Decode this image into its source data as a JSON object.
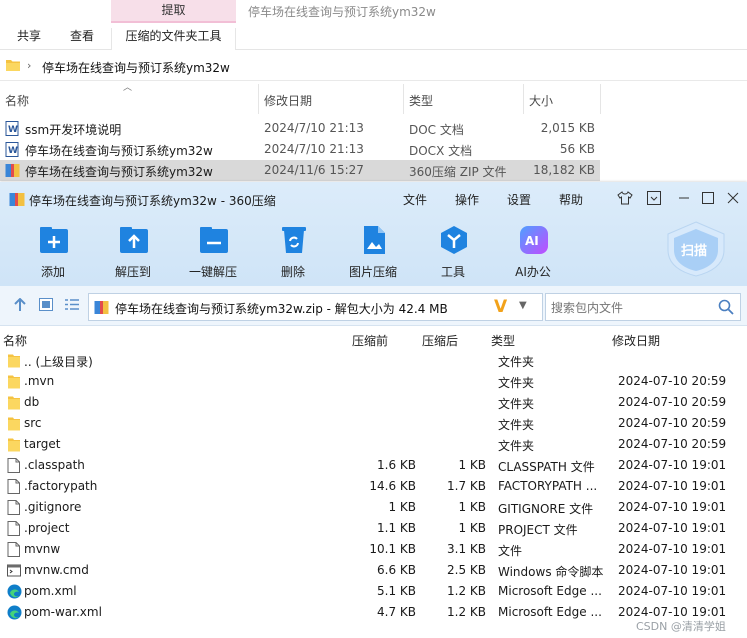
{
  "explorer": {
    "context_tab": "提取",
    "window_title": "停车场在线查询与预订系统ym32w",
    "tabs": {
      "share": "共享",
      "view": "查看",
      "tools": "压缩的文件夹工具"
    },
    "address": "停车场在线查询与预订系统ym32w",
    "columns": {
      "name": "名称",
      "date": "修改日期",
      "type": "类型",
      "size": "大小"
    },
    "files": [
      {
        "name": "ssm开发环境说明",
        "date": "2024/7/10 21:13",
        "type": "DOC 文档",
        "size": "2,015 KB",
        "icon": "word-doc-icon"
      },
      {
        "name": "停车场在线查询与预订系统ym32w",
        "date": "2024/7/10 21:13",
        "type": "DOCX 文档",
        "size": "56 KB",
        "icon": "word-doc-icon"
      },
      {
        "name": "停车场在线查询与预订系统ym32w",
        "date": "2024/11/6 15:27",
        "type": "360压缩 ZIP 文件",
        "size": "18,182 KB",
        "icon": "zip-archive-icon",
        "selected": true
      }
    ]
  },
  "zip": {
    "title": "停车场在线查询与预订系统ym32w - 360压缩",
    "menu": {
      "file": "文件",
      "operate": "操作",
      "settings": "设置",
      "help": "帮助"
    },
    "tools": {
      "add": "添加",
      "extract": "解压到",
      "oneclick": "一键解压",
      "delete": "删除",
      "imgzip": "图片压缩",
      "tools": "工具",
      "ai": "AI办公"
    },
    "scan": "扫描",
    "path": "停车场在线查询与预订系统ym32w.zip - 解包大小为 42.4 MB",
    "search_placeholder": "搜索包内文件",
    "columns": {
      "name": "名称",
      "before": "压缩前",
      "after": "压缩后",
      "type": "类型",
      "date": "修改日期"
    },
    "rows": [
      {
        "name": ".. (上级目录)",
        "before": "",
        "after": "",
        "type": "文件夹",
        "date": "",
        "icon": "folder-icon"
      },
      {
        "name": ".mvn",
        "before": "",
        "after": "",
        "type": "文件夹",
        "date": "2024-07-10 20:59",
        "icon": "folder-icon"
      },
      {
        "name": "db",
        "before": "",
        "after": "",
        "type": "文件夹",
        "date": "2024-07-10 20:59",
        "icon": "folder-icon"
      },
      {
        "name": "src",
        "before": "",
        "after": "",
        "type": "文件夹",
        "date": "2024-07-10 20:59",
        "icon": "folder-icon"
      },
      {
        "name": "target",
        "before": "",
        "after": "",
        "type": "文件夹",
        "date": "2024-07-10 20:59",
        "icon": "folder-icon"
      },
      {
        "name": ".classpath",
        "before": "1.6 KB",
        "after": "1 KB",
        "type": "CLASSPATH 文件",
        "date": "2024-07-10 19:01",
        "icon": "file-icon"
      },
      {
        "name": ".factorypath",
        "before": "14.6 KB",
        "after": "1.7 KB",
        "type": "FACTORYPATH ...",
        "date": "2024-07-10 19:01",
        "icon": "file-icon"
      },
      {
        "name": ".gitignore",
        "before": "1 KB",
        "after": "1 KB",
        "type": "GITIGNORE 文件",
        "date": "2024-07-10 19:01",
        "icon": "file-icon"
      },
      {
        "name": ".project",
        "before": "1.1 KB",
        "after": "1 KB",
        "type": "PROJECT 文件",
        "date": "2024-07-10 19:01",
        "icon": "file-icon"
      },
      {
        "name": "mvnw",
        "before": "10.1 KB",
        "after": "3.1 KB",
        "type": "文件",
        "date": "2024-07-10 19:01",
        "icon": "file-icon"
      },
      {
        "name": "mvnw.cmd",
        "before": "6.6 KB",
        "after": "2.5 KB",
        "type": "Windows 命令脚本",
        "date": "2024-07-10 19:01",
        "icon": "cmd-script-icon"
      },
      {
        "name": "pom.xml",
        "before": "5.1 KB",
        "after": "1.2 KB",
        "type": "Microsoft Edge ...",
        "date": "2024-07-10 19:01",
        "icon": "edge-icon"
      },
      {
        "name": "pom-war.xml",
        "before": "4.7 KB",
        "after": "1.2 KB",
        "type": "Microsoft Edge ...",
        "date": "2024-07-10 19:01",
        "icon": "edge-icon"
      }
    ]
  },
  "watermark": "CSDN @清清学姐"
}
